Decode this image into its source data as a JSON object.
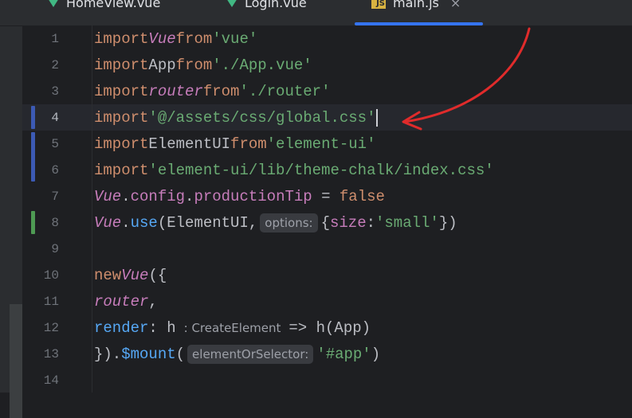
{
  "tabs": [
    {
      "label": "HomeView.vue",
      "icon": "vue-icon",
      "active": false
    },
    {
      "label": "Login.vue",
      "icon": "vue-icon",
      "active": false
    },
    {
      "label": "main.js",
      "icon": "js-icon",
      "active": true,
      "icon_text": "JS"
    }
  ],
  "close_glyph": "×",
  "lines": [
    {
      "n": "1"
    },
    {
      "n": "2"
    },
    {
      "n": "3"
    },
    {
      "n": "4"
    },
    {
      "n": "5"
    },
    {
      "n": "6"
    },
    {
      "n": "7"
    },
    {
      "n": "8"
    },
    {
      "n": "9"
    },
    {
      "n": "10"
    },
    {
      "n": "11"
    },
    {
      "n": "12"
    },
    {
      "n": "13"
    },
    {
      "n": "14"
    }
  ],
  "code": {
    "l1": {
      "kw": "import",
      "name": "Vue",
      "from": "from",
      "str": "'vue'"
    },
    "l2": {
      "kw": "import",
      "name": "App",
      "from": "from",
      "str": "'./App.vue'"
    },
    "l3": {
      "kw": "import",
      "name": "router",
      "from": "from",
      "str": "'./router'"
    },
    "l4": {
      "kw": "import",
      "str": "'@/assets/css/global.css'"
    },
    "l5": {
      "kw": "import",
      "name": "ElementUI",
      "from": "from",
      "str": "'element-ui'"
    },
    "l6": {
      "kw": "import",
      "str": "'element-ui/lib/theme-chalk/index.css'"
    },
    "l7": {
      "obj": "Vue",
      "dot1": ".",
      "p1": "config",
      "dot2": ".",
      "p2": "productionTip",
      "eq": " = ",
      "val": "false"
    },
    "l8": {
      "obj": "Vue",
      "dot": ".",
      "fn": "use",
      "open": "(ElementUI,",
      "hint": "options:",
      "brace_open": "{",
      "key": "size",
      "colon": ":",
      "str": "'small'",
      "close": "})"
    },
    "l10": {
      "kw": "new",
      "obj": "Vue",
      "rest": "({"
    },
    "l11": {
      "prop": "router",
      "rest": ","
    },
    "l12": {
      "prop": "render",
      "colon": ": h",
      "hint": ": CreateElement",
      "rest": "=> h(App)"
    },
    "l13": {
      "pre": "}).",
      "fn": "$mount",
      "open": "(",
      "hint": "elementOrSelector:",
      "str": "'#app'",
      "close": ")"
    }
  },
  "colors": {
    "background": "#1e1f22",
    "keyword": "#cf8e6d",
    "string": "#6aab73",
    "property": "#c77dbb",
    "function": "#56a8f5",
    "modified_marker": "#3c5ab4",
    "added_marker": "#4e9a53",
    "annotation_arrow": "#e02b2b",
    "active_tab_underline": "#3574f0"
  }
}
